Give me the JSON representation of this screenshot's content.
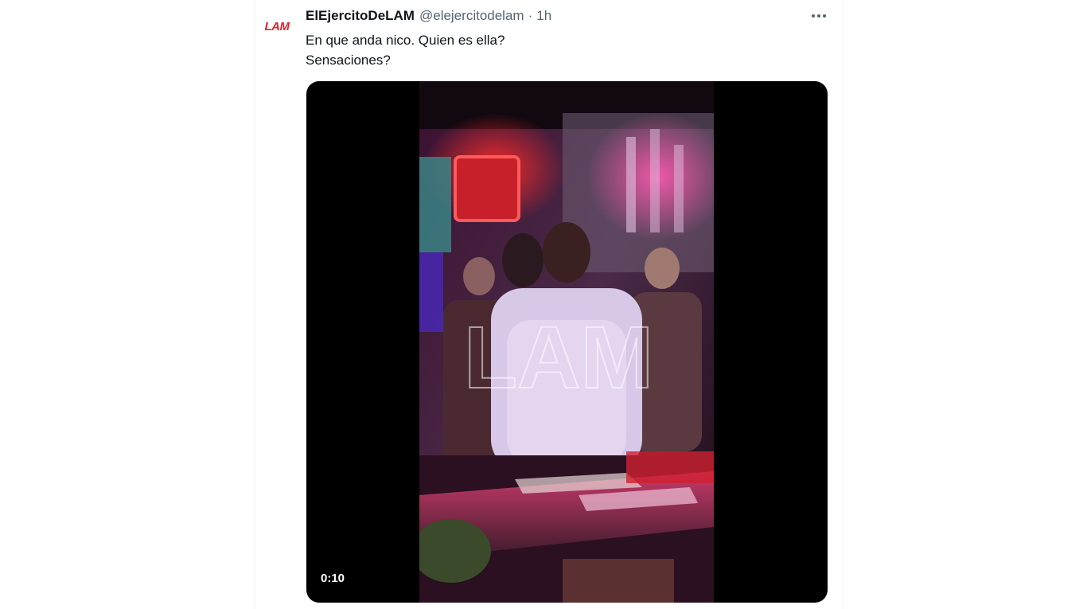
{
  "colors": {
    "brand_red": "#e3232b",
    "text_primary": "#0f1419",
    "text_secondary": "#536471",
    "accent_blue": "#1d9bf0"
  },
  "tweet": {
    "avatar_text": "LAM",
    "display_name": "ElEjercitoDeLAM",
    "handle": "@elejercitodelam",
    "separator": "·",
    "time": "1h",
    "more_icon": "more-horizontal-icon",
    "text_lines": [
      "En que anda nico. Quien es ella?",
      "Sensaciones?"
    ]
  },
  "media": {
    "type": "video",
    "duration": "0:10",
    "watermark": "LAM"
  }
}
